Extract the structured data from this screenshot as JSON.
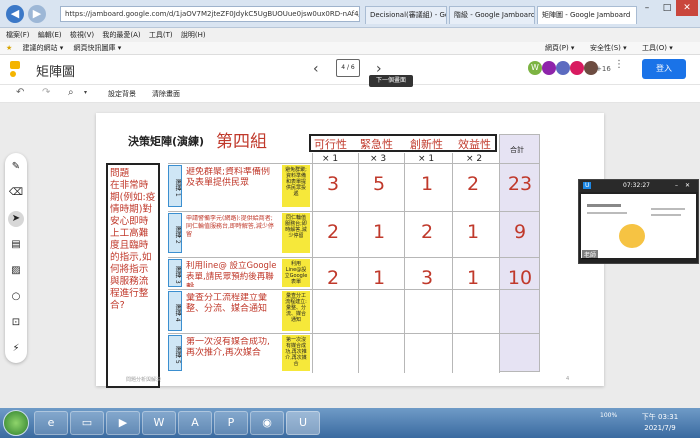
{
  "browser": {
    "address": "https://jamboard.google.com/d/1jaOV7M2jteZF0JdykC5UgBUOUue0jsw0ux0RD-nAf4/viewer?f=",
    "tabs": [
      "Decisional(審議組) - Google ...",
      "階級 - Google Jamboard",
      "矩陣圖 - Google Jamboard"
    ],
    "menu": [
      "檔案(F)",
      "編輯(E)",
      "檢視(V)",
      "我的最愛(A)",
      "工具(T)",
      "說明(H)"
    ],
    "favorites": [
      "建議的網站 ▾",
      "網頁快訊圖庫 ▾"
    ],
    "right_menu": [
      "網頁(P) ▾",
      "安全性(S) ▾",
      "工具(O) ▾"
    ]
  },
  "app": {
    "title": "矩陣圖",
    "frame_counter": "4 / 6",
    "tooltip": "下一個畫面",
    "avatars": [
      "W",
      "",
      "",
      "",
      "",
      ""
    ],
    "avatar_colors": [
      "#7cb342",
      "#8e24aa",
      "#5c6bc0",
      "#d81b60",
      "#6d4c41",
      "#00897b"
    ],
    "avatar_more": "+16",
    "login": "登入",
    "set_background": "設定背景",
    "clear_frame": "清除畫面"
  },
  "board": {
    "title": "決策矩陣(演練)",
    "group": "第四組",
    "headers": [
      "可行性",
      "緊急性",
      "創新性",
      "效益性"
    ],
    "weights": [
      "× 1",
      "× 3",
      "× 1",
      "× 2"
    ],
    "total_label": "合計",
    "problem": "問題\n在非常時期(例如:疫情時期)對安心即時上工高難度且臨時的指示,如何將指示與服務流程進行整合?",
    "options": [
      {
        "label": "選擇 1",
        "text": "避免群聚;資料準備例及表單提供民眾",
        "note": "避免群聚;資料準備和表單提供民眾投遞",
        "scores": [
          "3",
          "5",
          "1",
          "2"
        ],
        "total": "23"
      },
      {
        "label": "選擇 2",
        "text": "申請警備李元(網路):提供給商者;同仁輪值服務台,即時解答,減少停留",
        "note": "同仁輪值服務台;即時解答,減少停留",
        "scores": [
          "2",
          "1",
          "2",
          "1"
        ],
        "total": "9"
      },
      {
        "label": "選擇 3",
        "text": "利用line@ 設立Google表單,請民眾預約後再聯繫",
        "note": "利用Line@設立Google表單",
        "scores": [
          "2",
          "1",
          "3",
          "1"
        ],
        "total": "10"
      },
      {
        "label": "選擇 4",
        "text": "彙查分工流程建立彙整、分流、媒合通知",
        "note": "彙查分工流程建立:彙整、分流、媒合通知",
        "scores": [
          "",
          "",
          "",
          ""
        ],
        "total": ""
      },
      {
        "label": "選擇 5",
        "text": "第一次沒有媒合成功,再次推介,再次媒合",
        "note": "第一次沒有媒合成功,再次推介,再次媒合",
        "scores": [
          "",
          "",
          "",
          ""
        ],
        "total": ""
      }
    ],
    "footer_left": "問題分析與解決",
    "footer_right": "4"
  },
  "video": {
    "time": "07:32:27",
    "caption": "老師"
  },
  "taskbar": {
    "zoom": "100%",
    "clock_time": "下午 03:31",
    "clock_date": "2021/7/9"
  }
}
